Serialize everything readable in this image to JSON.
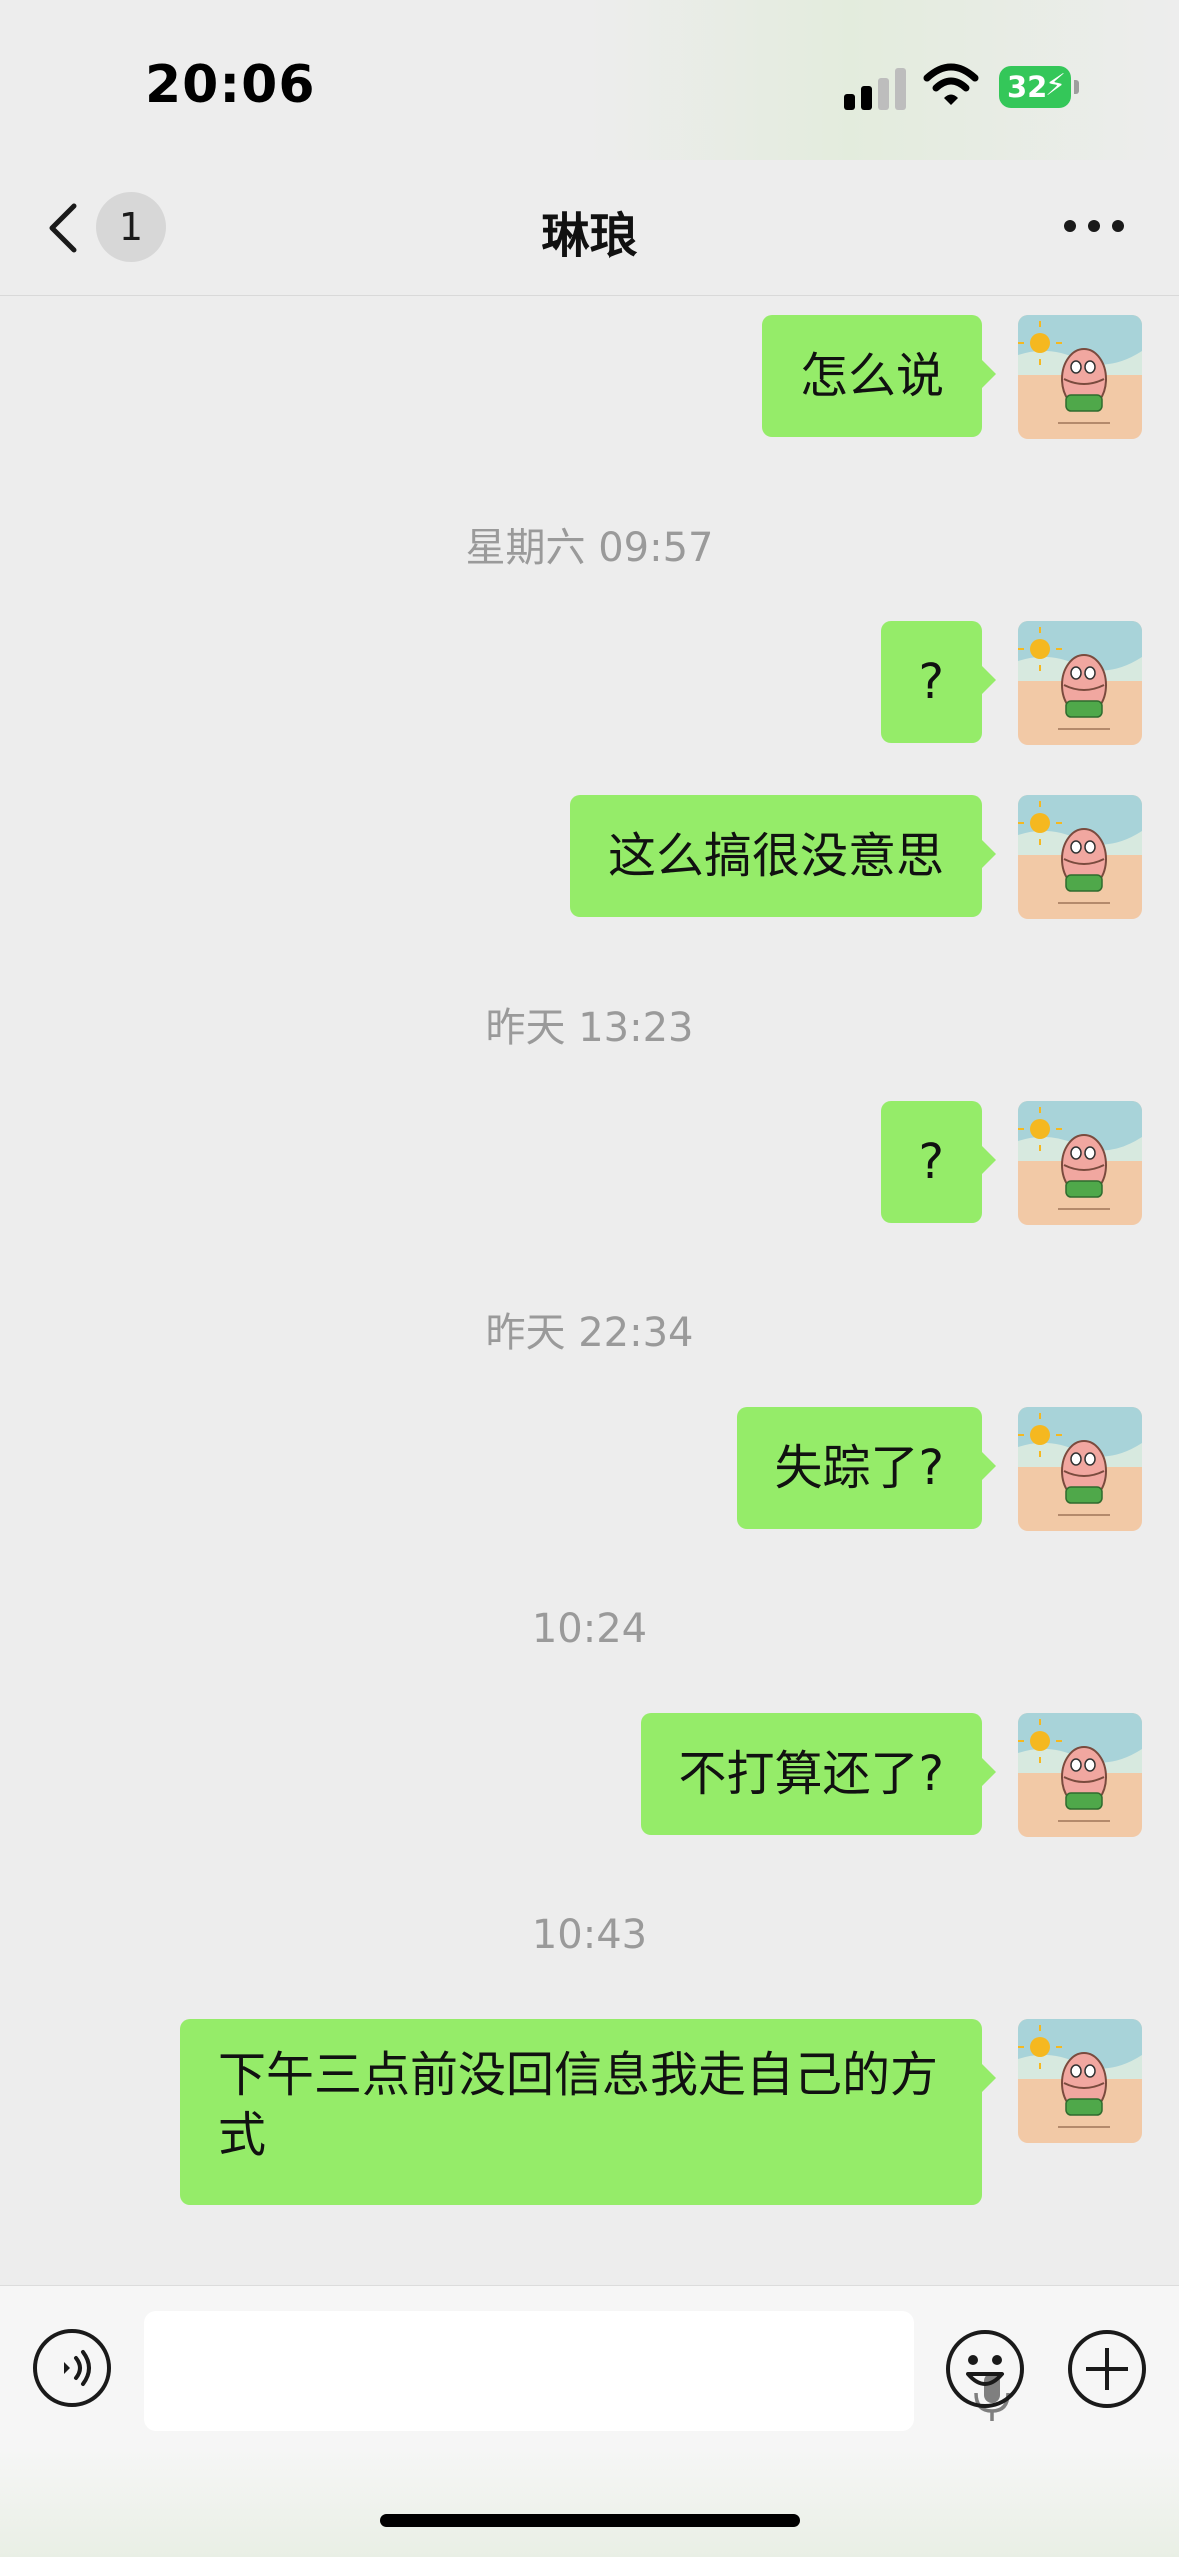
{
  "status_bar": {
    "time": "20:06",
    "battery": "32"
  },
  "nav": {
    "unread_count": "1",
    "title": "琳琅"
  },
  "messages": [
    {
      "text": "怎么说"
    },
    {
      "timestamp": "星期六 09:57"
    },
    {
      "text": "?"
    },
    {
      "text": "这么搞很没意思"
    },
    {
      "timestamp": "昨天 13:23"
    },
    {
      "text": "?"
    },
    {
      "timestamp": "昨天 22:34"
    },
    {
      "text": "失踪了?"
    },
    {
      "timestamp": "10:24"
    },
    {
      "text": "不打算还了?"
    },
    {
      "timestamp": "10:43"
    },
    {
      "text": "下午三点前没回信息我走自己的方式"
    }
  ],
  "colors": {
    "bubble": "#95ec69",
    "background": "#ededed",
    "battery": "#34c759"
  }
}
